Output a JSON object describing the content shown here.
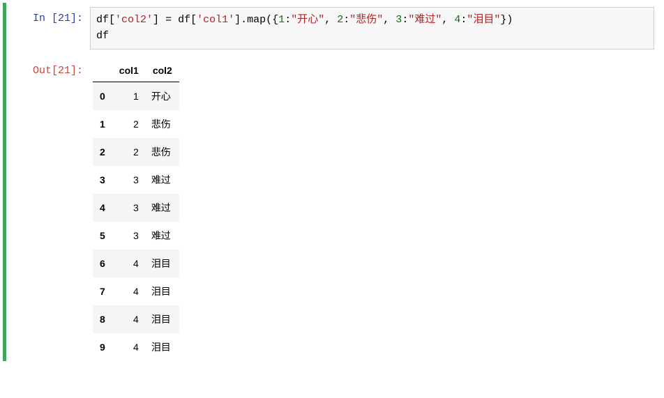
{
  "prompt_in": "In  [21]:",
  "prompt_out": "Out[21]:",
  "code_tokens": [
    {
      "t": "id",
      "v": "df"
    },
    {
      "t": "punct",
      "v": "["
    },
    {
      "t": "str",
      "v": "'col2'"
    },
    {
      "t": "punct",
      "v": "] "
    },
    {
      "t": "punct",
      "v": "="
    },
    {
      "t": "id",
      "v": " df"
    },
    {
      "t": "punct",
      "v": "["
    },
    {
      "t": "str",
      "v": "'col1'"
    },
    {
      "t": "punct",
      "v": "]."
    },
    {
      "t": "id",
      "v": "map"
    },
    {
      "t": "punct",
      "v": "({"
    },
    {
      "t": "num",
      "v": "1"
    },
    {
      "t": "punct",
      "v": ":"
    },
    {
      "t": "str",
      "v": "\"开心\""
    },
    {
      "t": "punct",
      "v": ", "
    },
    {
      "t": "num",
      "v": "2"
    },
    {
      "t": "punct",
      "v": ":"
    },
    {
      "t": "str",
      "v": "\"悲伤\""
    },
    {
      "t": "punct",
      "v": ", "
    },
    {
      "t": "num",
      "v": "3"
    },
    {
      "t": "punct",
      "v": ":"
    },
    {
      "t": "str",
      "v": "\"难过\""
    },
    {
      "t": "punct",
      "v": ", "
    },
    {
      "t": "num",
      "v": "4"
    },
    {
      "t": "punct",
      "v": ":"
    },
    {
      "t": "str",
      "v": "\"泪目\""
    },
    {
      "t": "punct",
      "v": "})\n"
    },
    {
      "t": "id",
      "v": "df"
    }
  ],
  "table": {
    "columns": [
      "",
      "col1",
      "col2"
    ],
    "rows": [
      {
        "idx": "0",
        "col1": "1",
        "col2": "开心"
      },
      {
        "idx": "1",
        "col1": "2",
        "col2": "悲伤"
      },
      {
        "idx": "2",
        "col1": "2",
        "col2": "悲伤"
      },
      {
        "idx": "3",
        "col1": "3",
        "col2": "难过"
      },
      {
        "idx": "4",
        "col1": "3",
        "col2": "难过"
      },
      {
        "idx": "5",
        "col1": "3",
        "col2": "难过"
      },
      {
        "idx": "6",
        "col1": "4",
        "col2": "泪目"
      },
      {
        "idx": "7",
        "col1": "4",
        "col2": "泪目"
      },
      {
        "idx": "8",
        "col1": "4",
        "col2": "泪目"
      },
      {
        "idx": "9",
        "col1": "4",
        "col2": "泪目"
      }
    ]
  }
}
